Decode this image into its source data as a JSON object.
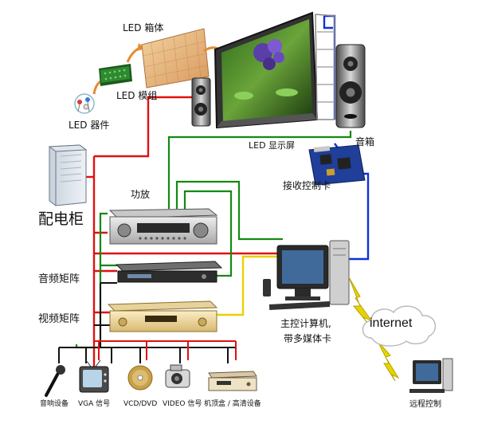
{
  "labels": {
    "led_cabinet": "LED 箱体",
    "led_module": "LED 模组",
    "led_device": "LED 器件",
    "led_display": "LED 显示屏",
    "speaker": "音箱",
    "receiver_card": "接收控制卡",
    "amplifier": "功放",
    "power_cabinet": "配电柜",
    "audio_matrix": "音频矩阵",
    "video_matrix": "视频矩阵",
    "main_computer_1": "主控计算机,",
    "main_computer_2": "带多媒体卡",
    "internet": "internet",
    "remote_control": "远程控制",
    "src_audio": "音响设备",
    "src_vga": "VGA 信号",
    "src_vcd": "VCD/DVD",
    "src_video": "VIDEO 信号",
    "src_stb": "机顶盒 / 高清设备"
  },
  "colors": {
    "power": "#e01010",
    "audio": "#138a13",
    "video": "#e8d000",
    "data": "#1030d8",
    "signal": "#111111",
    "flow_arrow": "#e88a2e",
    "lightning": "#e6d400"
  },
  "icons": [
    "led-lamp-icon",
    "led-module-icon",
    "led-cabinet-icon",
    "led-screen-icon",
    "speaker-icon",
    "receiver-card-icon",
    "power-cabinet-icon",
    "amplifier-icon",
    "audio-matrix-icon",
    "video-matrix-icon",
    "computer-icon",
    "internet-cloud-icon",
    "remote-computer-icon",
    "microphone-icon",
    "tv-icon",
    "disc-icon",
    "camera-icon",
    "set-top-box-icon",
    "lightning-icon"
  ]
}
